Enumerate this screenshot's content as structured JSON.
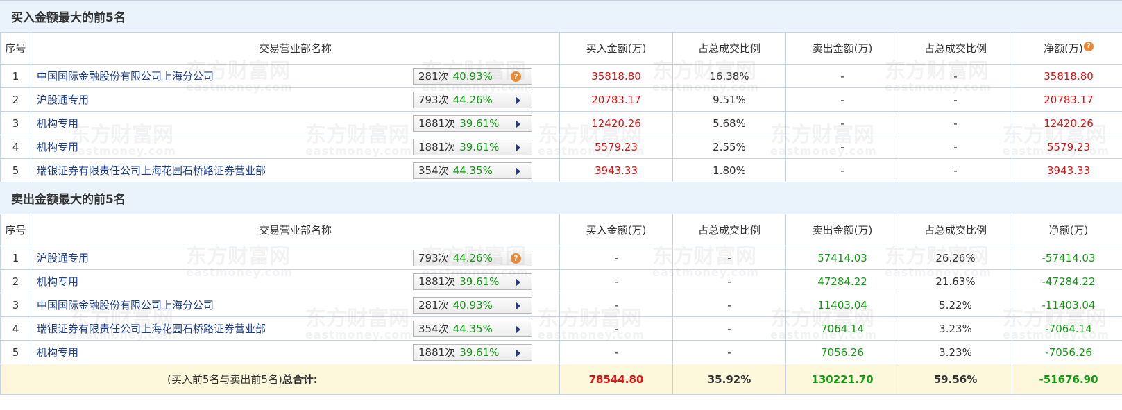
{
  "buy_section": {
    "title": "买入金额最大的前5名",
    "headers": [
      "序号",
      "交易营业部名称",
      "买入金额(万)",
      "占总成交比例",
      "卖出金额(万)",
      "占总成交比例",
      "净额(万)"
    ],
    "rows": [
      {
        "no": "1",
        "name": "中国国际金融股份有限公司上海分公司",
        "times": "281次",
        "rate": "40.93%",
        "buy": "35818.80",
        "buy_pct": "16.38%",
        "sell": "-",
        "sell_pct": "-",
        "net": "35818.80"
      },
      {
        "no": "2",
        "name": "沪股通专用",
        "times": "793次",
        "rate": "44.26%",
        "buy": "20783.17",
        "buy_pct": "9.51%",
        "sell": "-",
        "sell_pct": "-",
        "net": "20783.17"
      },
      {
        "no": "3",
        "name": "机构专用",
        "times": "1881次",
        "rate": "39.61%",
        "buy": "12420.26",
        "buy_pct": "5.68%",
        "sell": "-",
        "sell_pct": "-",
        "net": "12420.26"
      },
      {
        "no": "4",
        "name": "机构专用",
        "times": "1881次",
        "rate": "39.61%",
        "buy": "5579.23",
        "buy_pct": "2.55%",
        "sell": "-",
        "sell_pct": "-",
        "net": "5579.23"
      },
      {
        "no": "5",
        "name": "瑞银证券有限责任公司上海花园石桥路证券营业部",
        "times": "354次",
        "rate": "44.35%",
        "buy": "3943.33",
        "buy_pct": "1.80%",
        "sell": "-",
        "sell_pct": "-",
        "net": "3943.33"
      }
    ]
  },
  "sell_section": {
    "title": "卖出金额最大的前5名",
    "headers": [
      "序号",
      "交易营业部名称",
      "买入金额(万)",
      "占总成交比例",
      "卖出金额(万)",
      "占总成交比例",
      "净额(万)"
    ],
    "rows": [
      {
        "no": "1",
        "name": "沪股通专用",
        "times": "793次",
        "rate": "44.26%",
        "buy": "-",
        "buy_pct": "-",
        "sell": "57414.03",
        "sell_pct": "26.26%",
        "net": "-57414.03"
      },
      {
        "no": "2",
        "name": "机构专用",
        "times": "1881次",
        "rate": "39.61%",
        "buy": "-",
        "buy_pct": "-",
        "sell": "47284.22",
        "sell_pct": "21.63%",
        "net": "-47284.22"
      },
      {
        "no": "3",
        "name": "中国国际金融股份有限公司上海分公司",
        "times": "281次",
        "rate": "40.93%",
        "buy": "-",
        "buy_pct": "-",
        "sell": "11403.04",
        "sell_pct": "5.22%",
        "net": "-11403.04"
      },
      {
        "no": "4",
        "name": "瑞银证券有限责任公司上海花园石桥路证券营业部",
        "times": "354次",
        "rate": "44.35%",
        "buy": "-",
        "buy_pct": "-",
        "sell": "7064.14",
        "sell_pct": "3.23%",
        "net": "-7064.14"
      },
      {
        "no": "5",
        "name": "机构专用",
        "times": "1881次",
        "rate": "39.61%",
        "buy": "-",
        "buy_pct": "-",
        "sell": "7056.26",
        "sell_pct": "3.23%",
        "net": "-7056.26"
      }
    ]
  },
  "total": {
    "label_prefix": "(买入前5名与卖出前5名)",
    "label_bold": "总合计:",
    "buy": "78544.80",
    "buy_pct": "35.92%",
    "sell": "130221.70",
    "sell_pct": "59.56%",
    "net": "-51676.90"
  },
  "watermark": {
    "brand": "东方财富网",
    "domain": "eastmoney.com"
  },
  "colors": {
    "buy_red": "#dd1111",
    "sell_green": "#119911",
    "section_bg": "#eaf2fb",
    "total_bg": "#fdf8dc",
    "help_orange": "#ee8833"
  },
  "icons": {
    "row_first_action": "help-icon",
    "row_other_action": "play-arrow-icon",
    "net_header": "help-icon"
  }
}
